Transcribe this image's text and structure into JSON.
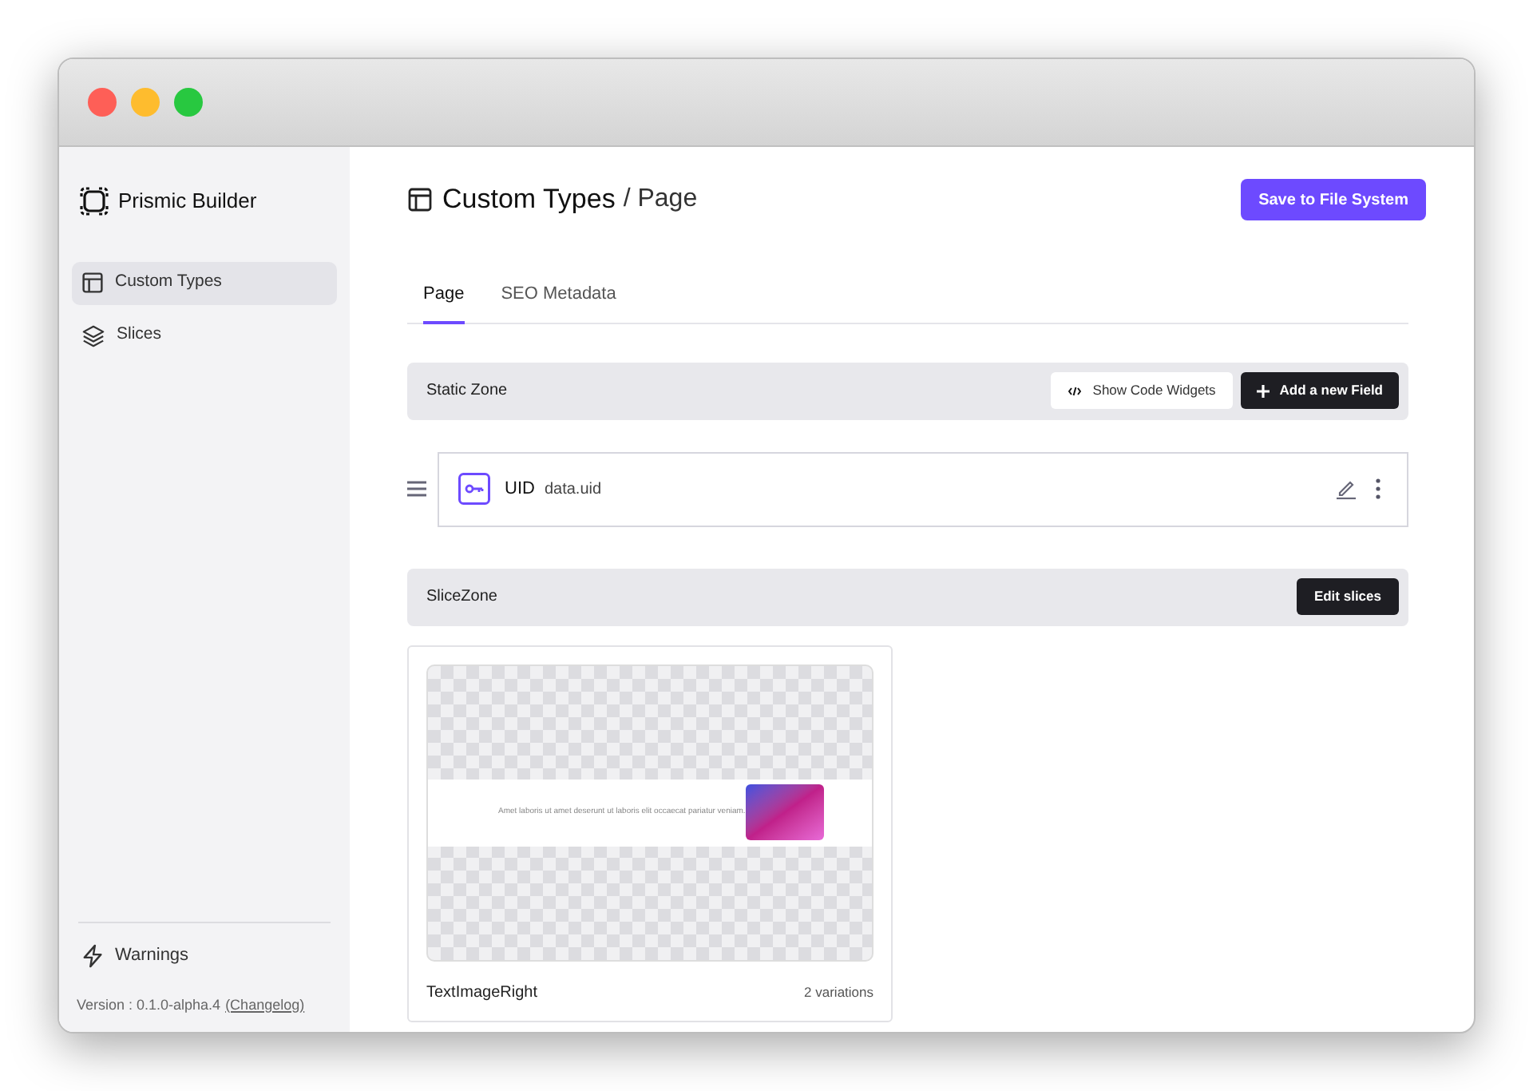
{
  "sidebar": {
    "brand": "Prismic Builder",
    "items": [
      {
        "label": "Custom Types",
        "selected": true,
        "kind": "types"
      },
      {
        "label": "Slices",
        "selected": false,
        "kind": "slices"
      }
    ],
    "warnings": "Warnings",
    "version": "Version : 0.1.0-alpha.4",
    "changelog": "(Changelog)"
  },
  "header": {
    "title": "Custom Types",
    "subtitle": "/ Page",
    "save_button": "Save to File System"
  },
  "tabs": [
    {
      "label": "Page",
      "selected": true
    },
    {
      "label": "SEO Metadata",
      "selected": false
    }
  ],
  "static_zone": {
    "title": "Static Zone",
    "code_button": "Show Code Widgets",
    "add_button": "Add a new Field",
    "fields": [
      {
        "name": "UID",
        "key": "data.uid"
      }
    ]
  },
  "slice_zone": {
    "title": "SliceZone",
    "edit_button": "Edit slices",
    "slices": [
      {
        "name": "TextImageRight",
        "variations": "2 variations",
        "preview_text": "Amet laboris ut amet deserunt ut laboris elit occaecat pariatur veniam."
      }
    ]
  }
}
